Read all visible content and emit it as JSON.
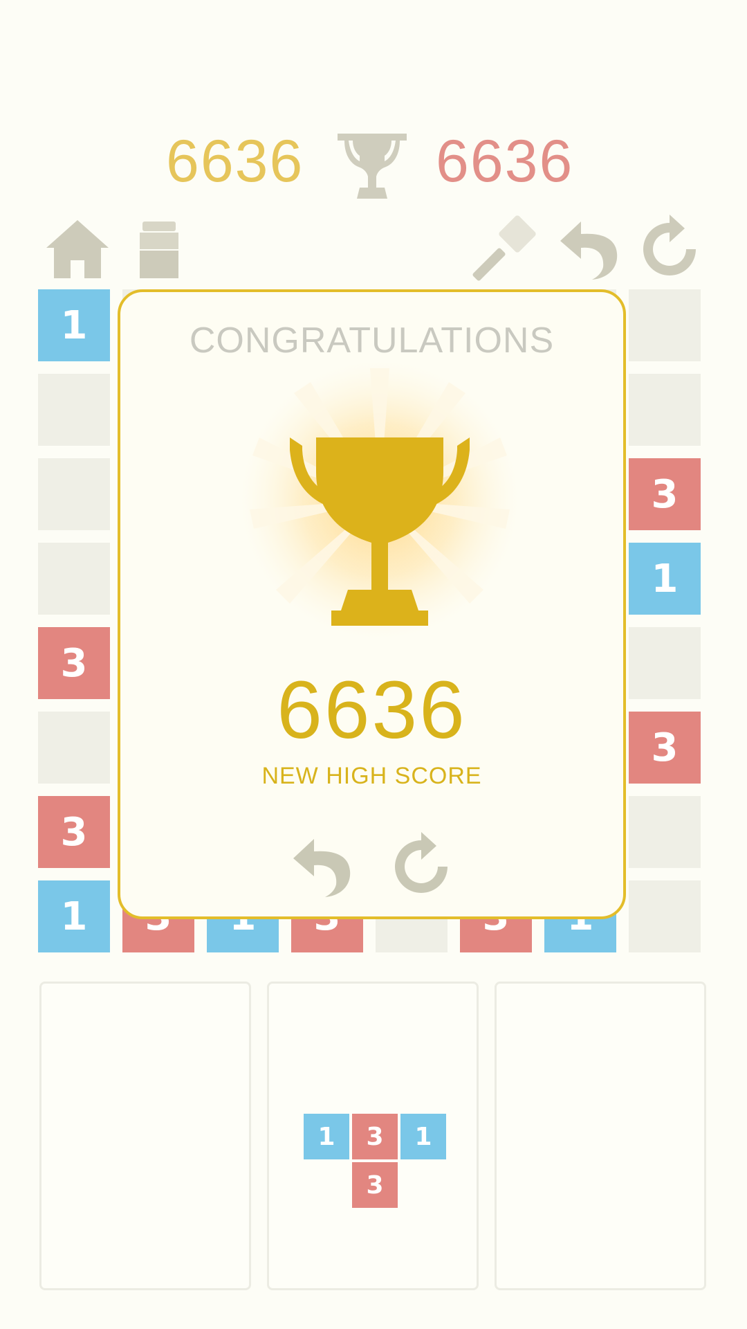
{
  "header": {
    "current_score": "6636",
    "best_score": "6636"
  },
  "toolbar": {
    "home": "home-icon",
    "bin": "bin-icon",
    "hammer": "hammer-icon",
    "undo": "undo-icon",
    "restart": "restart-icon"
  },
  "board": {
    "tiles": [
      {
        "col": 0,
        "row": 0,
        "value": "1"
      },
      {
        "col": 7,
        "row": 2,
        "value": "3"
      },
      {
        "col": 7,
        "row": 3,
        "value": "1"
      },
      {
        "col": 0,
        "row": 4,
        "value": "3"
      },
      {
        "col": 7,
        "row": 5,
        "value": "3"
      },
      {
        "col": 0,
        "row": 6,
        "value": "3"
      },
      {
        "col": 0,
        "row": 7,
        "value": "1"
      },
      {
        "col": 1,
        "row": 7,
        "value": "3"
      },
      {
        "col": 2,
        "row": 7,
        "value": "1"
      },
      {
        "col": 3,
        "row": 7,
        "value": "3"
      },
      {
        "col": 5,
        "row": 7,
        "value": "3"
      },
      {
        "col": 6,
        "row": 7,
        "value": "1"
      }
    ]
  },
  "modal": {
    "title": "CONGRATULATIONS",
    "score": "6636",
    "subtitle": "NEW HIGH SCORE"
  },
  "next_piece": {
    "tiles": [
      {
        "col": 0,
        "row": 0,
        "value": "1"
      },
      {
        "col": 1,
        "row": 0,
        "value": "3"
      },
      {
        "col": 2,
        "row": 0,
        "value": "1"
      },
      {
        "col": 1,
        "row": 1,
        "value": "3"
      }
    ]
  },
  "colors": {
    "gold": "#d8b31c",
    "blue_tile": "#7ac7e8",
    "red_tile": "#e28680",
    "icon_gray": "#cbc9b8"
  }
}
